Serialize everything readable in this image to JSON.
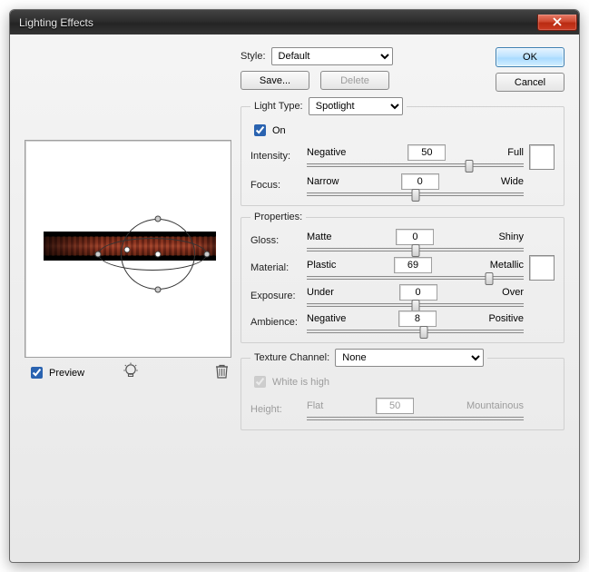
{
  "window": {
    "title": "Lighting Effects"
  },
  "buttons": {
    "ok": "OK",
    "cancel": "Cancel",
    "save": "Save...",
    "delete": "Delete"
  },
  "style": {
    "label": "Style:",
    "selected": "Default"
  },
  "preview": {
    "label": "Preview",
    "checked": true
  },
  "lightType": {
    "legend": "Light Type:",
    "selected": "Spotlight",
    "onLabel": "On",
    "onChecked": true,
    "intensity": {
      "label": "Intensity:",
      "min": "Negative",
      "max": "Full",
      "value": "50",
      "pct": 75
    },
    "focus": {
      "label": "Focus:",
      "min": "Narrow",
      "max": "Wide",
      "value": "0",
      "pct": 50
    }
  },
  "properties": {
    "legend": "Properties:",
    "gloss": {
      "label": "Gloss:",
      "min": "Matte",
      "max": "Shiny",
      "value": "0",
      "pct": 50
    },
    "material": {
      "label": "Material:",
      "min": "Plastic",
      "max": "Metallic",
      "value": "69",
      "pct": 84
    },
    "exposure": {
      "label": "Exposure:",
      "min": "Under",
      "max": "Over",
      "value": "0",
      "pct": 50
    },
    "ambience": {
      "label": "Ambience:",
      "min": "Negative",
      "max": "Positive",
      "value": "8",
      "pct": 54
    }
  },
  "texture": {
    "legend": "Texture Channel:",
    "selected": "None",
    "whiteHigh": "White is high",
    "height": {
      "label": "Height:",
      "min": "Flat",
      "max": "Mountainous",
      "value": "50",
      "pct": 50
    }
  }
}
